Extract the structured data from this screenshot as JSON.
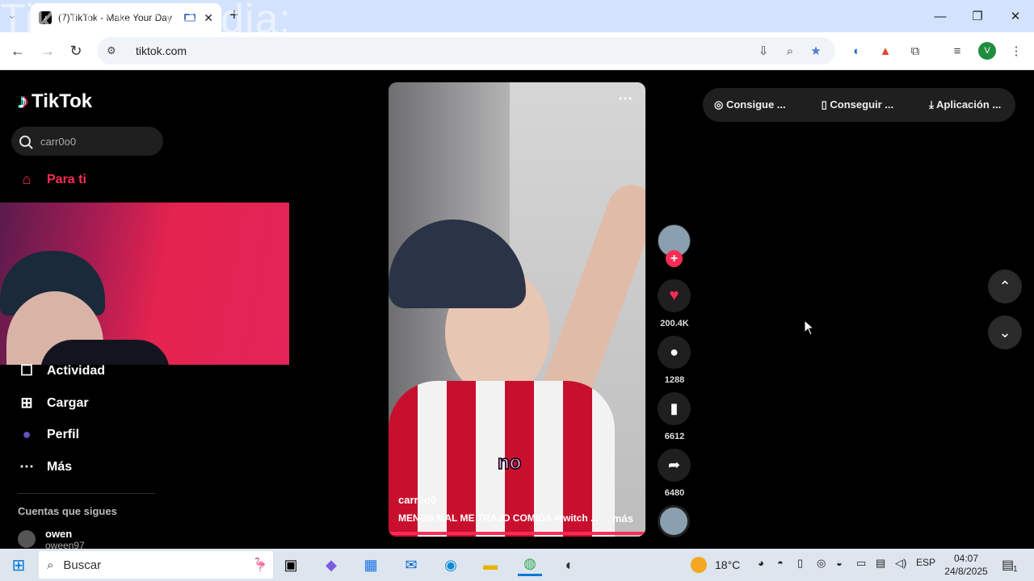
{
  "browser": {
    "tab_title": "(7)TikTok - Make Your Day",
    "url": "tiktok.com",
    "overlay_text": "Tiktoks del dia:",
    "profile_initial": "V"
  },
  "sidebar": {
    "logo": "TikTok",
    "search_value": "carr0o0",
    "items": [
      {
        "label": "Para ti",
        "icon": "home-icon"
      },
      {
        "label": "Actividad",
        "icon": "inbox-icon"
      },
      {
        "label": "Cargar",
        "icon": "upload-icon"
      },
      {
        "label": "Perfil",
        "icon": "profile-icon"
      },
      {
        "label": "Más",
        "icon": "more-icon"
      }
    ],
    "following_title": "Cuentas que sigues",
    "account_name": "owen",
    "account_handle": "oween97"
  },
  "video": {
    "username": "carr0o0",
    "description": "MENOS MAL ME TRAJO COMIDA #twitch ...",
    "more": "más",
    "caption": "no"
  },
  "actions": {
    "likes": "200.4K",
    "comments": "1288",
    "saves": "6612",
    "shares": "6480"
  },
  "topbar": {
    "coins": "Consigue ...",
    "app_get": "Conseguir ...",
    "app_download": "Aplicación ..."
  },
  "taskbar": {
    "search_placeholder": "Buscar",
    "weather_temp": "18°C",
    "lang": "ESP",
    "time": "04:07",
    "date": "24/8/2025",
    "notifications": "1"
  },
  "colors": {
    "accent": "#fe2c55",
    "tab_strip": "#d3e3fd"
  }
}
